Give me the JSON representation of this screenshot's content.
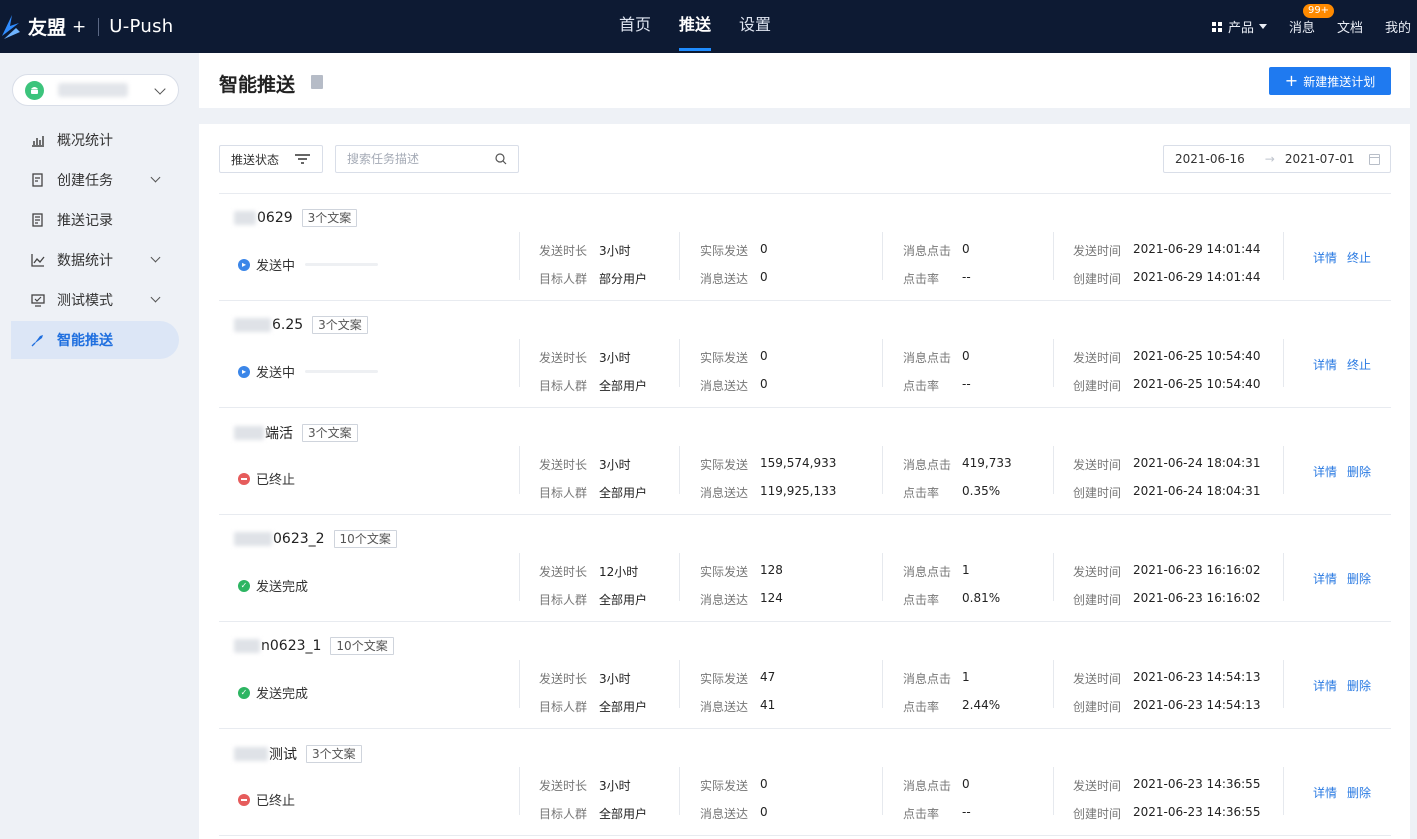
{
  "brand": {
    "name": "友盟",
    "plus": "+",
    "product": "U-Push"
  },
  "topnav": [
    "首页",
    "推送",
    "设置"
  ],
  "topnav_active": "推送",
  "topright": {
    "product": "产品",
    "messages": "消息",
    "messages_badge": "99+",
    "docs": "文档",
    "mine": "我的"
  },
  "sidebar": {
    "menu": [
      {
        "label": "概况统计",
        "icon": "bar-chart-icon",
        "expandable": false
      },
      {
        "label": "创建任务",
        "icon": "document-edit-icon",
        "expandable": true
      },
      {
        "label": "推送记录",
        "icon": "document-list-icon",
        "expandable": false
      },
      {
        "label": "数据统计",
        "icon": "line-chart-icon",
        "expandable": true
      },
      {
        "label": "测试模式",
        "icon": "monitor-icon",
        "expandable": true
      },
      {
        "label": "智能推送",
        "icon": "rocket-icon",
        "expandable": false
      }
    ],
    "active": "智能推送"
  },
  "header": {
    "title": "智能推送",
    "new_button": "新建推送计划"
  },
  "filters": {
    "status_label": "推送状态",
    "search_placeholder": "搜索任务描述",
    "date_start": "2021-06-16",
    "date_end": "2021-07-01",
    "date_arrow": "→"
  },
  "labels": {
    "duration": "发送时长",
    "audience": "目标人群",
    "actual_sent": "实际发送",
    "delivered": "消息送达",
    "clicks": "消息点击",
    "ctr": "点击率",
    "send_time": "发送时间",
    "create_time": "创建时间"
  },
  "tasks": [
    {
      "name": "0629",
      "tag": "3个文案",
      "status": "发送中",
      "status_type": "sending",
      "duration": "3小时",
      "audience": "部分用户",
      "actual_sent": "0",
      "delivered": "0",
      "clicks": "0",
      "ctr": "--",
      "send_time": "2021-06-29 14:01:44",
      "create_time": "2021-06-29 14:01:44",
      "actions": [
        "详情",
        "终止"
      ]
    },
    {
      "name": "6.25",
      "tag": "3个文案",
      "status": "发送中",
      "status_type": "sending",
      "duration": "3小时",
      "audience": "全部用户",
      "actual_sent": "0",
      "delivered": "0",
      "clicks": "0",
      "ctr": "--",
      "send_time": "2021-06-25 10:54:40",
      "create_time": "2021-06-25 10:54:40",
      "actions": [
        "详情",
        "终止"
      ]
    },
    {
      "name": "端活",
      "tag": "3个文案",
      "status": "已终止",
      "status_type": "stopped",
      "duration": "3小时",
      "audience": "全部用户",
      "actual_sent": "159,574,933",
      "delivered": "119,925,133",
      "clicks": "419,733",
      "ctr": "0.35%",
      "send_time": "2021-06-24 18:04:31",
      "create_time": "2021-06-24 18:04:31",
      "actions": [
        "详情",
        "删除"
      ]
    },
    {
      "name": "0623_2",
      "tag": "10个文案",
      "status": "发送完成",
      "status_type": "done",
      "duration": "12小时",
      "audience": "全部用户",
      "actual_sent": "128",
      "delivered": "124",
      "clicks": "1",
      "ctr": "0.81%",
      "send_time": "2021-06-23 16:16:02",
      "create_time": "2021-06-23 16:16:02",
      "actions": [
        "详情",
        "删除"
      ]
    },
    {
      "name": "n0623_1",
      "tag": "10个文案",
      "status": "发送完成",
      "status_type": "done",
      "duration": "3小时",
      "audience": "全部用户",
      "actual_sent": "47",
      "delivered": "41",
      "clicks": "1",
      "ctr": "2.44%",
      "send_time": "2021-06-23 14:54:13",
      "create_time": "2021-06-23 14:54:13",
      "actions": [
        "详情",
        "删除"
      ]
    },
    {
      "name": "测试",
      "tag": "3个文案",
      "status": "已终止",
      "status_type": "stopped",
      "duration": "3小时",
      "audience": "全部用户",
      "actual_sent": "0",
      "delivered": "0",
      "clicks": "0",
      "ctr": "--",
      "send_time": "2021-06-23 14:36:55",
      "create_time": "2021-06-23 14:36:55",
      "actions": [
        "详情",
        "删除"
      ]
    }
  ]
}
